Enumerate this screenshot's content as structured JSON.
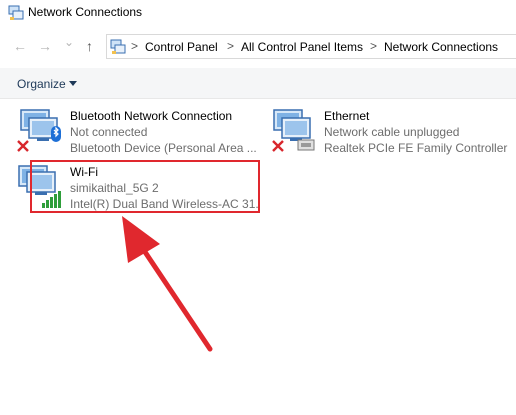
{
  "window": {
    "title": "Network Connections"
  },
  "nav": {
    "back_glyph": "←",
    "forward_glyph": "→",
    "dropdown_glyph": "⌄",
    "up_glyph": "↑"
  },
  "breadcrumb": {
    "separator": ">",
    "items": [
      "Control Panel",
      "All Control Panel Items",
      "Network Connections"
    ]
  },
  "toolbar": {
    "organize_label": "Organize"
  },
  "connections": [
    {
      "name": "Bluetooth Network Connection",
      "status": "Not connected",
      "device": "Bluetooth Device (Personal Area ...",
      "icon": "bluetooth-network-adapter-icon",
      "badge": "disconnected-x-icon"
    },
    {
      "name": "Ethernet",
      "status": "Network cable unplugged",
      "device": "Realtek PCIe FE Family Controller",
      "icon": "ethernet-adapter-icon",
      "badge": "disconnected-x-icon"
    },
    {
      "name": "Wi-Fi",
      "status": "simikaithal_5G 2",
      "device": "Intel(R) Dual Band Wireless-AC 31...",
      "icon": "wifi-adapter-icon",
      "badge": "signal-bars-icon"
    }
  ],
  "colors": {
    "highlight": "#e0282e",
    "arrow": "#e0282e",
    "signal": "#2e9e3a",
    "error_x": "#d8262c",
    "bluetooth": "#1d6fd6"
  }
}
